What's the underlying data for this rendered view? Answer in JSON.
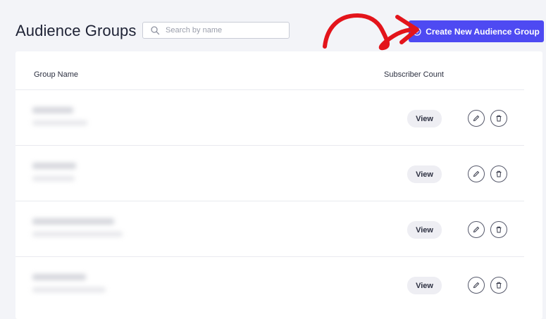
{
  "page": {
    "title": "Audience Groups"
  },
  "search": {
    "placeholder": "Search by name",
    "value": "",
    "icon": "search-icon"
  },
  "create_button": {
    "label": "Create New Audience Group",
    "icon": "plus-circle-icon",
    "color": "#4e4af2"
  },
  "annotation": {
    "color": "#e3141b",
    "icon": "arrow-annotation"
  },
  "table": {
    "headers": {
      "group_name": "Group Name",
      "subscriber_count": "Subscriber Count"
    },
    "rows": [
      {
        "view_label": "View",
        "edit_icon": "pencil-icon",
        "delete_icon": "trash-icon"
      },
      {
        "view_label": "View",
        "edit_icon": "pencil-icon",
        "delete_icon": "trash-icon"
      },
      {
        "view_label": "View",
        "edit_icon": "pencil-icon",
        "delete_icon": "trash-icon"
      },
      {
        "view_label": "View",
        "edit_icon": "pencil-icon",
        "delete_icon": "trash-icon"
      }
    ]
  }
}
